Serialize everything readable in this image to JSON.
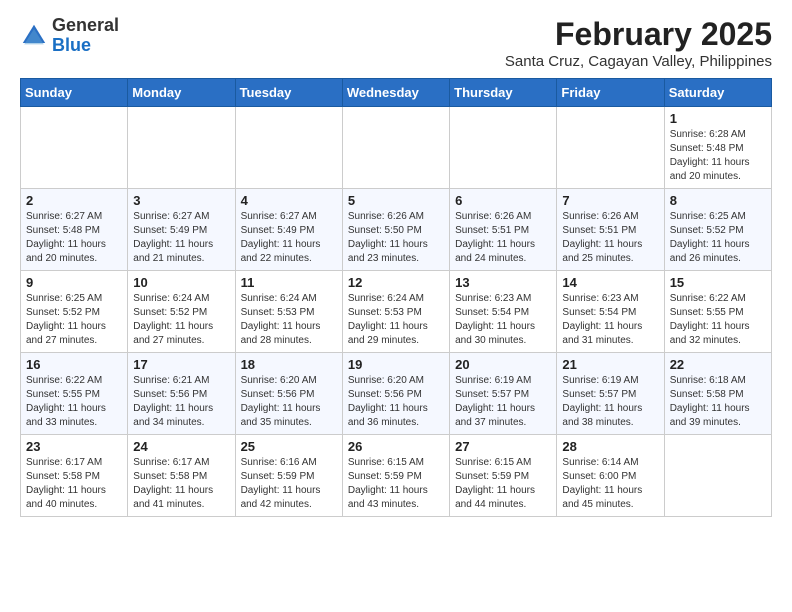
{
  "logo": {
    "general": "General",
    "blue": "Blue"
  },
  "title": "February 2025",
  "subtitle": "Santa Cruz, Cagayan Valley, Philippines",
  "days_of_week": [
    "Sunday",
    "Monday",
    "Tuesday",
    "Wednesday",
    "Thursday",
    "Friday",
    "Saturday"
  ],
  "weeks": [
    [
      {
        "day": "",
        "info": ""
      },
      {
        "day": "",
        "info": ""
      },
      {
        "day": "",
        "info": ""
      },
      {
        "day": "",
        "info": ""
      },
      {
        "day": "",
        "info": ""
      },
      {
        "day": "",
        "info": ""
      },
      {
        "day": "1",
        "info": "Sunrise: 6:28 AM\nSunset: 5:48 PM\nDaylight: 11 hours and 20 minutes."
      }
    ],
    [
      {
        "day": "2",
        "info": "Sunrise: 6:27 AM\nSunset: 5:48 PM\nDaylight: 11 hours and 20 minutes."
      },
      {
        "day": "3",
        "info": "Sunrise: 6:27 AM\nSunset: 5:49 PM\nDaylight: 11 hours and 21 minutes."
      },
      {
        "day": "4",
        "info": "Sunrise: 6:27 AM\nSunset: 5:49 PM\nDaylight: 11 hours and 22 minutes."
      },
      {
        "day": "5",
        "info": "Sunrise: 6:26 AM\nSunset: 5:50 PM\nDaylight: 11 hours and 23 minutes."
      },
      {
        "day": "6",
        "info": "Sunrise: 6:26 AM\nSunset: 5:51 PM\nDaylight: 11 hours and 24 minutes."
      },
      {
        "day": "7",
        "info": "Sunrise: 6:26 AM\nSunset: 5:51 PM\nDaylight: 11 hours and 25 minutes."
      },
      {
        "day": "8",
        "info": "Sunrise: 6:25 AM\nSunset: 5:52 PM\nDaylight: 11 hours and 26 minutes."
      }
    ],
    [
      {
        "day": "9",
        "info": "Sunrise: 6:25 AM\nSunset: 5:52 PM\nDaylight: 11 hours and 27 minutes."
      },
      {
        "day": "10",
        "info": "Sunrise: 6:24 AM\nSunset: 5:52 PM\nDaylight: 11 hours and 27 minutes."
      },
      {
        "day": "11",
        "info": "Sunrise: 6:24 AM\nSunset: 5:53 PM\nDaylight: 11 hours and 28 minutes."
      },
      {
        "day": "12",
        "info": "Sunrise: 6:24 AM\nSunset: 5:53 PM\nDaylight: 11 hours and 29 minutes."
      },
      {
        "day": "13",
        "info": "Sunrise: 6:23 AM\nSunset: 5:54 PM\nDaylight: 11 hours and 30 minutes."
      },
      {
        "day": "14",
        "info": "Sunrise: 6:23 AM\nSunset: 5:54 PM\nDaylight: 11 hours and 31 minutes."
      },
      {
        "day": "15",
        "info": "Sunrise: 6:22 AM\nSunset: 5:55 PM\nDaylight: 11 hours and 32 minutes."
      }
    ],
    [
      {
        "day": "16",
        "info": "Sunrise: 6:22 AM\nSunset: 5:55 PM\nDaylight: 11 hours and 33 minutes."
      },
      {
        "day": "17",
        "info": "Sunrise: 6:21 AM\nSunset: 5:56 PM\nDaylight: 11 hours and 34 minutes."
      },
      {
        "day": "18",
        "info": "Sunrise: 6:20 AM\nSunset: 5:56 PM\nDaylight: 11 hours and 35 minutes."
      },
      {
        "day": "19",
        "info": "Sunrise: 6:20 AM\nSunset: 5:56 PM\nDaylight: 11 hours and 36 minutes."
      },
      {
        "day": "20",
        "info": "Sunrise: 6:19 AM\nSunset: 5:57 PM\nDaylight: 11 hours and 37 minutes."
      },
      {
        "day": "21",
        "info": "Sunrise: 6:19 AM\nSunset: 5:57 PM\nDaylight: 11 hours and 38 minutes."
      },
      {
        "day": "22",
        "info": "Sunrise: 6:18 AM\nSunset: 5:58 PM\nDaylight: 11 hours and 39 minutes."
      }
    ],
    [
      {
        "day": "23",
        "info": "Sunrise: 6:17 AM\nSunset: 5:58 PM\nDaylight: 11 hours and 40 minutes."
      },
      {
        "day": "24",
        "info": "Sunrise: 6:17 AM\nSunset: 5:58 PM\nDaylight: 11 hours and 41 minutes."
      },
      {
        "day": "25",
        "info": "Sunrise: 6:16 AM\nSunset: 5:59 PM\nDaylight: 11 hours and 42 minutes."
      },
      {
        "day": "26",
        "info": "Sunrise: 6:15 AM\nSunset: 5:59 PM\nDaylight: 11 hours and 43 minutes."
      },
      {
        "day": "27",
        "info": "Sunrise: 6:15 AM\nSunset: 5:59 PM\nDaylight: 11 hours and 44 minutes."
      },
      {
        "day": "28",
        "info": "Sunrise: 6:14 AM\nSunset: 6:00 PM\nDaylight: 11 hours and 45 minutes."
      },
      {
        "day": "",
        "info": ""
      }
    ]
  ]
}
